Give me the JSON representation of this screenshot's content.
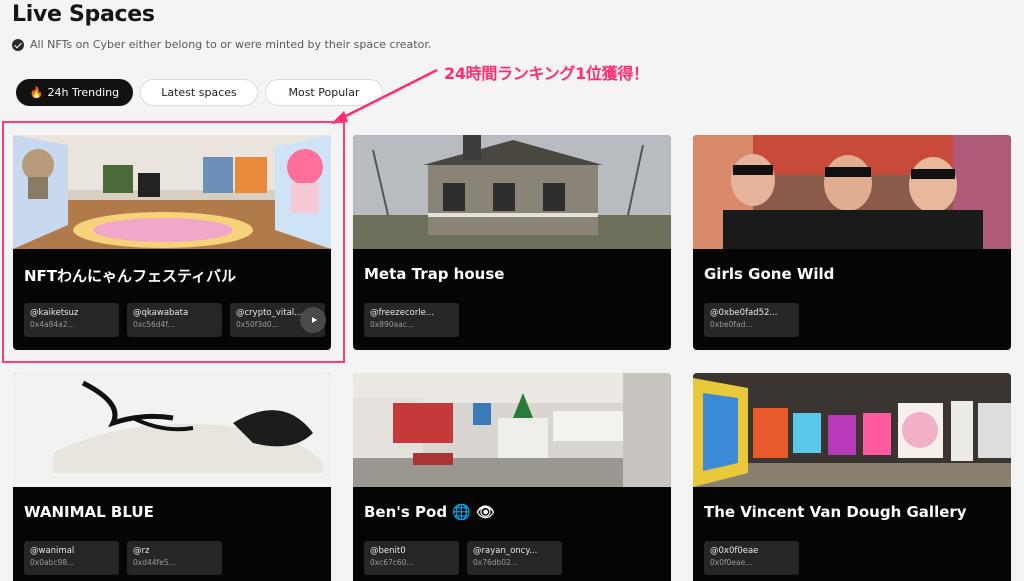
{
  "header": {
    "title": "Live Spaces",
    "subtitle": "All NFTs on Cyber either belong to or were minted by their space creator."
  },
  "tabs": [
    {
      "label": "24h Trending",
      "icon": "fire-icon",
      "active": true
    },
    {
      "label": "Latest spaces",
      "active": false
    },
    {
      "label": "Most Popular",
      "active": false
    }
  ],
  "annotation": {
    "text": "24時間ランキング1位獲得！",
    "color": "#ff2d6f"
  },
  "cards": [
    {
      "title": "NFTわんにゃんフェスティバル",
      "owners": [
        {
          "handle": "@kaiketsuz",
          "address": "0x4a84a2..."
        },
        {
          "handle": "@qkawabata",
          "address": "0xc56d4f..."
        },
        {
          "handle": "@crypto_vital...",
          "address": "0x50f3d0..."
        }
      ]
    },
    {
      "title": "Meta Trap house",
      "owners": [
        {
          "handle": "@freezecorle...",
          "address": "0x890aac..."
        }
      ]
    },
    {
      "title": "Girls Gone Wild",
      "owners": [
        {
          "handle": "@0xbe0fad52...",
          "address": "0xbe0fad..."
        }
      ]
    },
    {
      "title": "WANIMAL BLUE",
      "owners": [
        {
          "handle": "@wanimal",
          "address": "0x0abc98..."
        },
        {
          "handle": "@rz",
          "address": "0xd44fe5..."
        }
      ]
    },
    {
      "title": "Ben's Pod 🌐 👁",
      "owners": [
        {
          "handle": "@benit0",
          "address": "0xc67c60..."
        },
        {
          "handle": "@rayan_oncy...",
          "address": "0x76db02..."
        }
      ]
    },
    {
      "title": "The Vincent Van Dough Gallery",
      "owners": [
        {
          "handle": "@0x0f0eae",
          "address": "0x0f0eae..."
        }
      ]
    }
  ]
}
